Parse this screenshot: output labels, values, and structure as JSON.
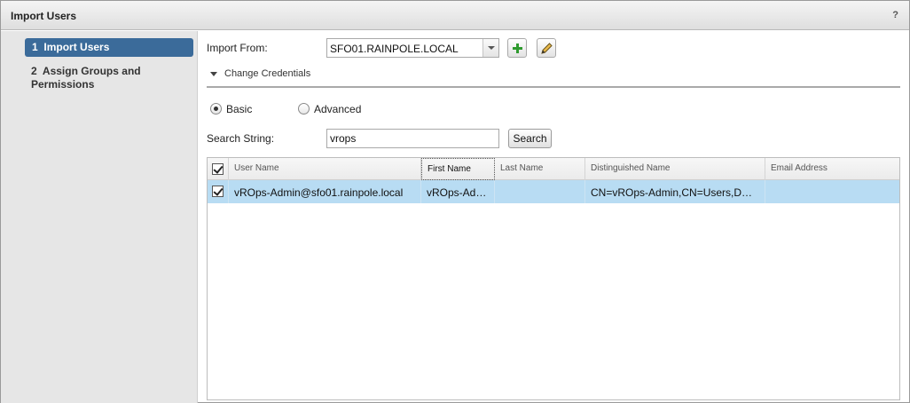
{
  "dialog": {
    "title": "Import Users",
    "help": "?"
  },
  "wizard": {
    "steps": [
      {
        "number": "1",
        "label": "Import Users"
      },
      {
        "number": "2",
        "label": "Assign Groups and Permissions"
      }
    ]
  },
  "form": {
    "import_from_label": "Import From:",
    "import_from_value": "SFO01.RAINPOLE.LOCAL",
    "change_credentials": "Change Credentials",
    "radio_basic": "Basic",
    "radio_advanced": "Advanced",
    "selected_mode": "Basic",
    "search_label": "Search String:",
    "search_value": "vrops",
    "search_button": "Search"
  },
  "table": {
    "columns": [
      "User Name",
      "First Name",
      "Last Name",
      "Distinguished Name",
      "Email Address"
    ],
    "sorted_column": "First Name",
    "rows": [
      {
        "selected": true,
        "user_name": "vROps-Admin@sfo01.rainpole.local",
        "first_name": "vROps-Ad…",
        "last_name": "",
        "distinguished_name": "CN=vROps-Admin,CN=Users,D…",
        "email": ""
      }
    ]
  },
  "colors": {
    "active_step": "#3b6b9a",
    "row_selected": "#b8dcf3",
    "add_icon": "#2e9a2e"
  }
}
